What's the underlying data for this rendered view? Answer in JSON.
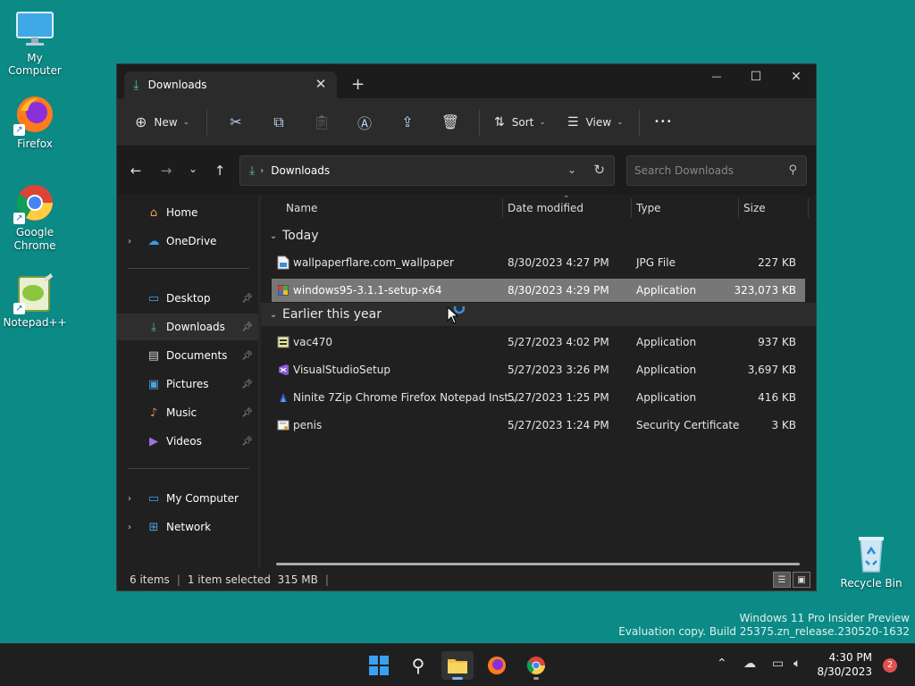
{
  "desktop": {
    "icons": [
      {
        "label": "My Computer"
      },
      {
        "label": "Firefox"
      },
      {
        "label": "Google Chrome"
      },
      {
        "label": "Notepad++"
      },
      {
        "label": "Recycle Bin"
      }
    ]
  },
  "window": {
    "tab_title": "Downloads",
    "close_tab": "✕",
    "new_tab": "+",
    "controls": {
      "minimize": "—",
      "maximize": "☐",
      "close": "✕"
    }
  },
  "toolbar": {
    "new_label": "New",
    "sort_label": "Sort",
    "view_label": "View",
    "more_label": "•••"
  },
  "address": {
    "crumb": "Downloads",
    "search_placeholder": "Search Downloads"
  },
  "sidebar": {
    "items": [
      {
        "label": "Home",
        "icon": "home-icon"
      },
      {
        "label": "OneDrive",
        "icon": "cloud-icon"
      },
      {
        "label": "Desktop",
        "icon": "desktop-icon"
      },
      {
        "label": "Downloads",
        "icon": "download-icon"
      },
      {
        "label": "Documents",
        "icon": "document-icon"
      },
      {
        "label": "Pictures",
        "icon": "pictures-icon"
      },
      {
        "label": "Music",
        "icon": "music-icon"
      },
      {
        "label": "Videos",
        "icon": "videos-icon"
      },
      {
        "label": "My Computer",
        "icon": "computer-icon"
      },
      {
        "label": "Network",
        "icon": "network-icon"
      }
    ]
  },
  "columns": {
    "name": "Name",
    "date": "Date modified",
    "type": "Type",
    "size": "Size"
  },
  "groups": [
    {
      "label": "Today",
      "files": [
        {
          "name": "wallpaperflare.com_wallpaper",
          "date": "8/30/2023 4:27 PM",
          "type": "JPG File",
          "size": "227 KB"
        },
        {
          "name": "windows95-3.1.1-setup-x64",
          "date": "8/30/2023 4:29 PM",
          "type": "Application",
          "size": "323,073 KB"
        }
      ]
    },
    {
      "label": "Earlier this year",
      "files": [
        {
          "name": "vac470",
          "date": "5/27/2023 4:02 PM",
          "type": "Application",
          "size": "937 KB"
        },
        {
          "name": "VisualStudioSetup",
          "date": "5/27/2023 3:26 PM",
          "type": "Application",
          "size": "3,697 KB"
        },
        {
          "name": "Ninite 7Zip Chrome Firefox Notepad Inst...",
          "date": "5/27/2023 1:25 PM",
          "type": "Application",
          "size": "416 KB"
        },
        {
          "name": "penis",
          "date": "5/27/2023 1:24 PM",
          "type": "Security Certificate",
          "size": "3 KB"
        }
      ]
    }
  ],
  "status": {
    "items": "6 items",
    "selected": "1 item selected  315 MB"
  },
  "watermark": {
    "line1": "Windows 11 Pro Insider Preview",
    "line2": "Evaluation copy. Build 25375.zn_release.230520-1632"
  },
  "taskbar": {
    "time": "4:30 PM",
    "date": "8/30/2023",
    "notifications": "2"
  }
}
